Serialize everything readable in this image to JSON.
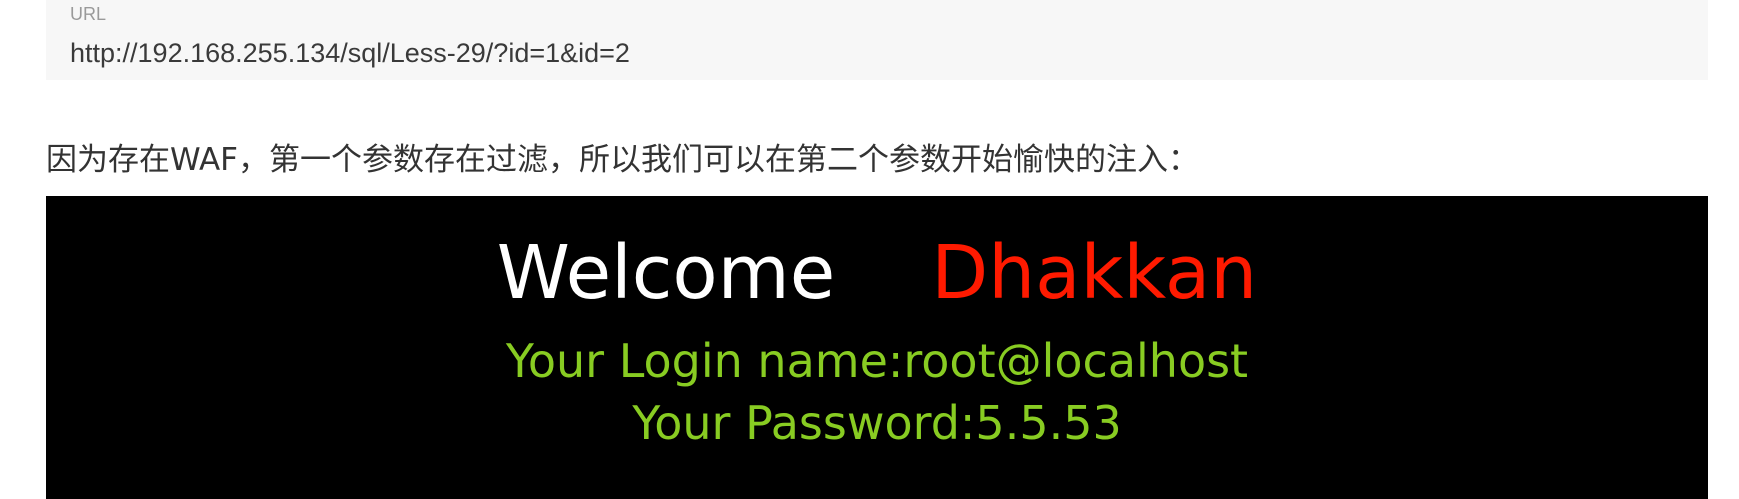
{
  "url_block": {
    "label": "URL",
    "value": "http://192.168.255.134/sql/Less-29/?id=1&id=2"
  },
  "paragraph": "因为存在WAF，第一个参数存在过滤，所以我们可以在第二个参数开始愉快的注入：",
  "terminal": {
    "welcome": "Welcome",
    "name": "Dhakkan",
    "login_line": "Your Login name:root@localhost",
    "password_line": "Your Password:5.5.53",
    "colors": {
      "background": "#000000",
      "welcome": "#ffffff",
      "name": "#ff1a00",
      "info": "#88cc22"
    }
  }
}
